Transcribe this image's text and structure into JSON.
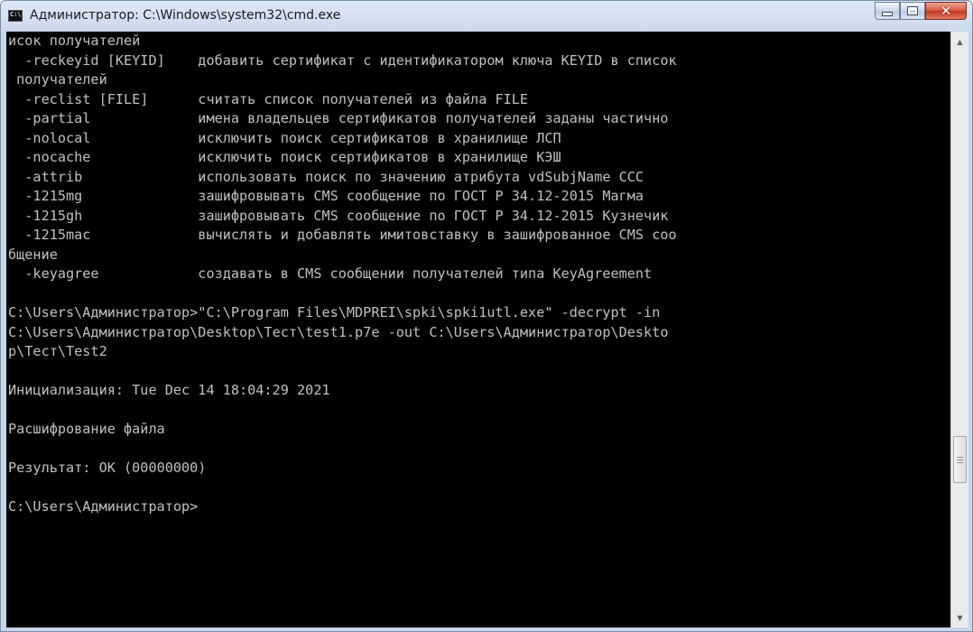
{
  "window": {
    "title": "Администратор: C:\\Windows\\system32\\cmd.exe",
    "icon": "cmd-console-icon",
    "buttons": {
      "minimize": "minimize-icon",
      "maximize": "maximize-icon",
      "close": "✕"
    }
  },
  "console": {
    "lines": [
      "исок получателей",
      "  -reckeyid [KEYID]    добавить сертификат с идентификатором ключа KEYID в список",
      " получателей",
      "  -reclist [FILE]      считать список получателей из файла FILE",
      "  -partial             имена владельцев сертификатов получателей заданы частично",
      "  -nolocal             исключить поиск сертификатов в хранилище ЛСП",
      "  -nocache             исключить поиск сертификатов в хранилище КЭШ",
      "  -attrib              использовать поиск по значению атрибута vdSubjName CCC",
      "  -1215mg              зашифровывать CMS сообщение по ГОСТ Р 34.12-2015 Магма",
      "  -1215gh              зашифровывать CMS сообщение по ГОСТ Р 34.12-2015 Кузнечик",
      "  -1215mac             вычислять и добавлять имитовставку в зашифрованное CMS соо",
      "бщение",
      "  -keyagree            создавать в CMS сообщении получателей типа KeyAgreement",
      "",
      "C:\\Users\\Администратор>\"C:\\Program Files\\MDPREI\\spki\\spki1utl.exe\" -decrypt -in",
      "C:\\Users\\Администратор\\Desktop\\Тест\\test1.p7e -out C:\\Users\\Администратор\\Deskto",
      "p\\Тест\\Test2",
      "",
      "Инициализация: Tue Dec 14 18:04:29 2021",
      "",
      "Расшифрование файла",
      "",
      "Результат: OK (00000000)",
      "",
      "C:\\Users\\Администратор>"
    ]
  },
  "colors": {
    "console_bg": "#000000",
    "console_fg": "#c0c0c0"
  }
}
